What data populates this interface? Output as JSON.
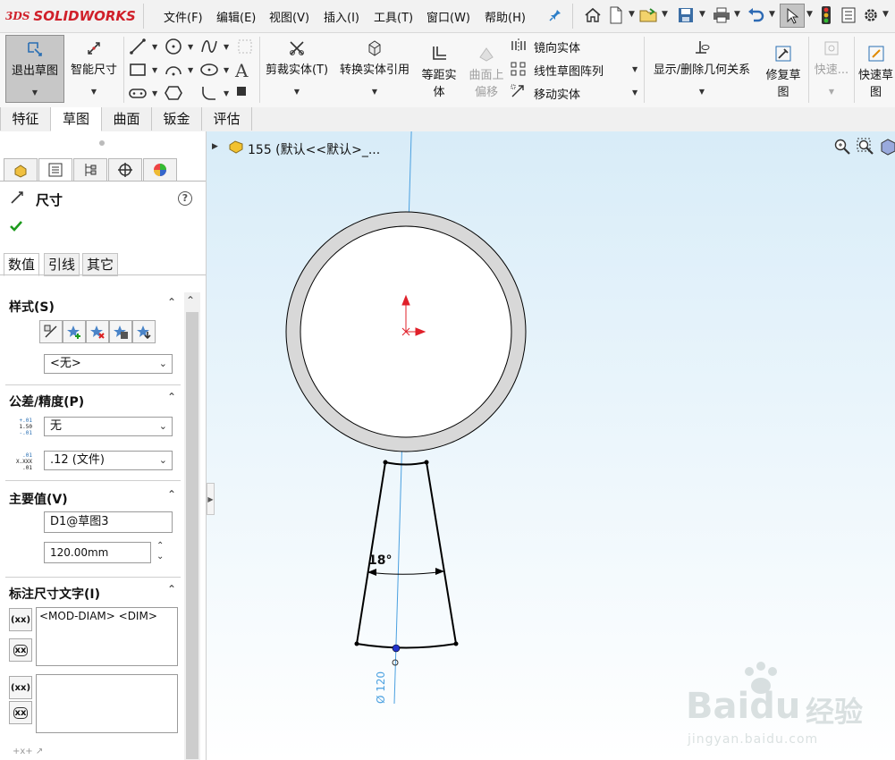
{
  "app": {
    "brand_prefix": "3DS",
    "brand": "SOLIDWORKS"
  },
  "menu": [
    "文件(F)",
    "编辑(E)",
    "视图(V)",
    "插入(I)",
    "工具(T)",
    "窗口(W)",
    "帮助(H)"
  ],
  "toolbar": {
    "exit_sketch": "退出草图",
    "smart_dimension": "智能尺寸",
    "trim_entities": "剪裁实体(T)",
    "convert_entities": "转换实体引用",
    "offset_entities": [
      "等距实",
      "体"
    ],
    "offset_on_surface": [
      "曲面上",
      "偏移"
    ],
    "mirror_entities": "镜向实体",
    "linear_pattern": "线性草图阵列",
    "move_entities": "移动实体",
    "display_relations": "显示/删除几何关系",
    "repair_sketch": [
      "修复草",
      "图"
    ],
    "quick_snaps": "快速...",
    "rapid_sketch": [
      "快速草",
      "图"
    ]
  },
  "tabs": [
    {
      "label": "特征",
      "active": false
    },
    {
      "label": "草图",
      "active": true
    },
    {
      "label": "曲面",
      "active": false
    },
    {
      "label": "钣金",
      "active": false
    },
    {
      "label": "评估",
      "active": false
    }
  ],
  "panel": {
    "title": "尺寸",
    "ok_icon": "checkmark-icon",
    "help_icon": "help-icon",
    "subtabs": [
      {
        "label": "数值",
        "active": true
      },
      {
        "label": "引线",
        "active": false
      },
      {
        "label": "其它",
        "active": false
      }
    ],
    "style": {
      "title": "样式(S)",
      "selected": "<无>"
    },
    "tolerance": {
      "title": "公差/精度(P)",
      "tolerance_icon_text": [
        "+.01",
        "1.50",
        "-.01"
      ],
      "precision_icon_text": [
        ".01",
        "X.XXX",
        ".01"
      ],
      "tolerance_value": "无",
      "precision_value": ".12 (文件)"
    },
    "primary": {
      "title": "主要值(V)",
      "name": "D1@草图3",
      "value": "120.00mm"
    },
    "dim_text": {
      "title": "标注尺寸文字(I)",
      "content": "<MOD-DIAM> <DIM>",
      "content2": ""
    }
  },
  "tree": {
    "item": "155  (默认<<默认>_..."
  },
  "sketch": {
    "angle_label": "18°",
    "diameter_label": "Ø 120",
    "ring_color": "#d8d8d8",
    "line_color": "#000000",
    "centerline_color": "#4aa0e0",
    "origin_color": "#e0202a"
  },
  "watermark": {
    "brand": "Baidu",
    "cn": "经验",
    "url": "jingyan.baidu.com"
  }
}
